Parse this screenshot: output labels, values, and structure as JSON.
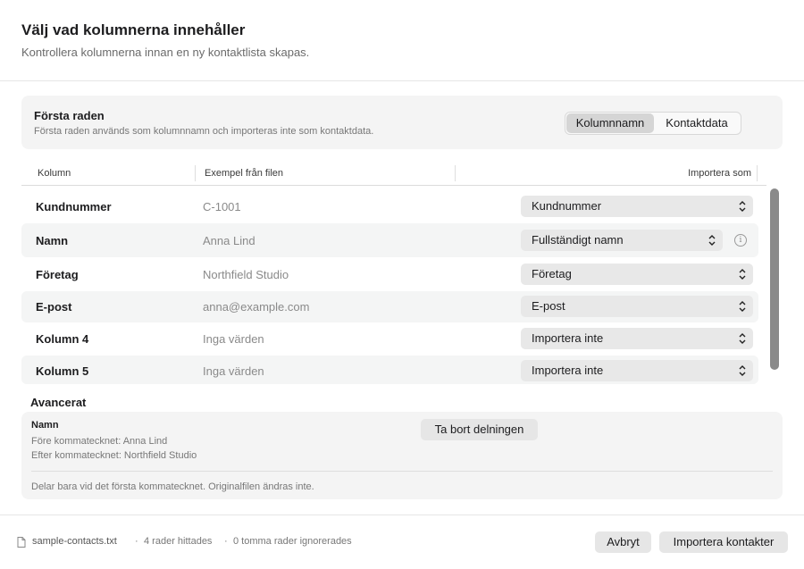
{
  "dialog": {
    "title": "Välj vad kolumnerna innehåller",
    "subtitle": "Kontrollera kolumnerna innan en ny kontaktlista skapas."
  },
  "first_row": {
    "title": "Första raden",
    "description": "Första raden används som kolumnnamn och importeras inte som kontaktdata.",
    "options": [
      "Kolumnnamn",
      "Kontaktdata"
    ],
    "selected": "Kolumnnamn"
  },
  "table": {
    "headers": {
      "column": "Kolumn",
      "example": "Exempel från filen",
      "import_as": "Importera som"
    },
    "rows": [
      {
        "column": "Kundnummer",
        "example": "C-1001",
        "import_as": "Kundnummer"
      },
      {
        "column": "Namn",
        "example": "Anna Lind",
        "import_as": "Fullständigt namn",
        "info_icon": "info-icon"
      },
      {
        "column": "Företag",
        "example": "Northfield Studio",
        "import_as": "Företag"
      },
      {
        "column": "E-post",
        "example": "anna@example.com",
        "import_as": "E-post"
      },
      {
        "column": "Kolumn 4",
        "example": "Inga värden",
        "import_as": "Importera inte"
      },
      {
        "column": "Kolumn 5",
        "example": "Inga värden",
        "import_as": "Importera inte"
      }
    ]
  },
  "advanced": {
    "title": "Avancerat",
    "field_name": "Namn",
    "before_comma": "Före kommatecknet: Anna Lind",
    "after_comma": "Efter kommatecknet: Northfield Studio",
    "remove_split_label": "Ta bort delningen",
    "note": "Delar bara vid det första kommatecknet. Originalfilen ändras inte."
  },
  "footer": {
    "file_icon": "document-icon",
    "file_name": "sample-contacts.txt",
    "separator": "·",
    "rows_found": "4 rader hittades",
    "empty_rows": "0 tomma rader ignorerades",
    "cancel_label": "Avbryt",
    "import_label": "Importera kontakter"
  },
  "colors": {
    "panel_bg": "#f4f4f4",
    "popup_bg": "#e8e8e8",
    "segment_active": "#d5d5d5",
    "scroll_thumb": "#8a8a8a"
  }
}
